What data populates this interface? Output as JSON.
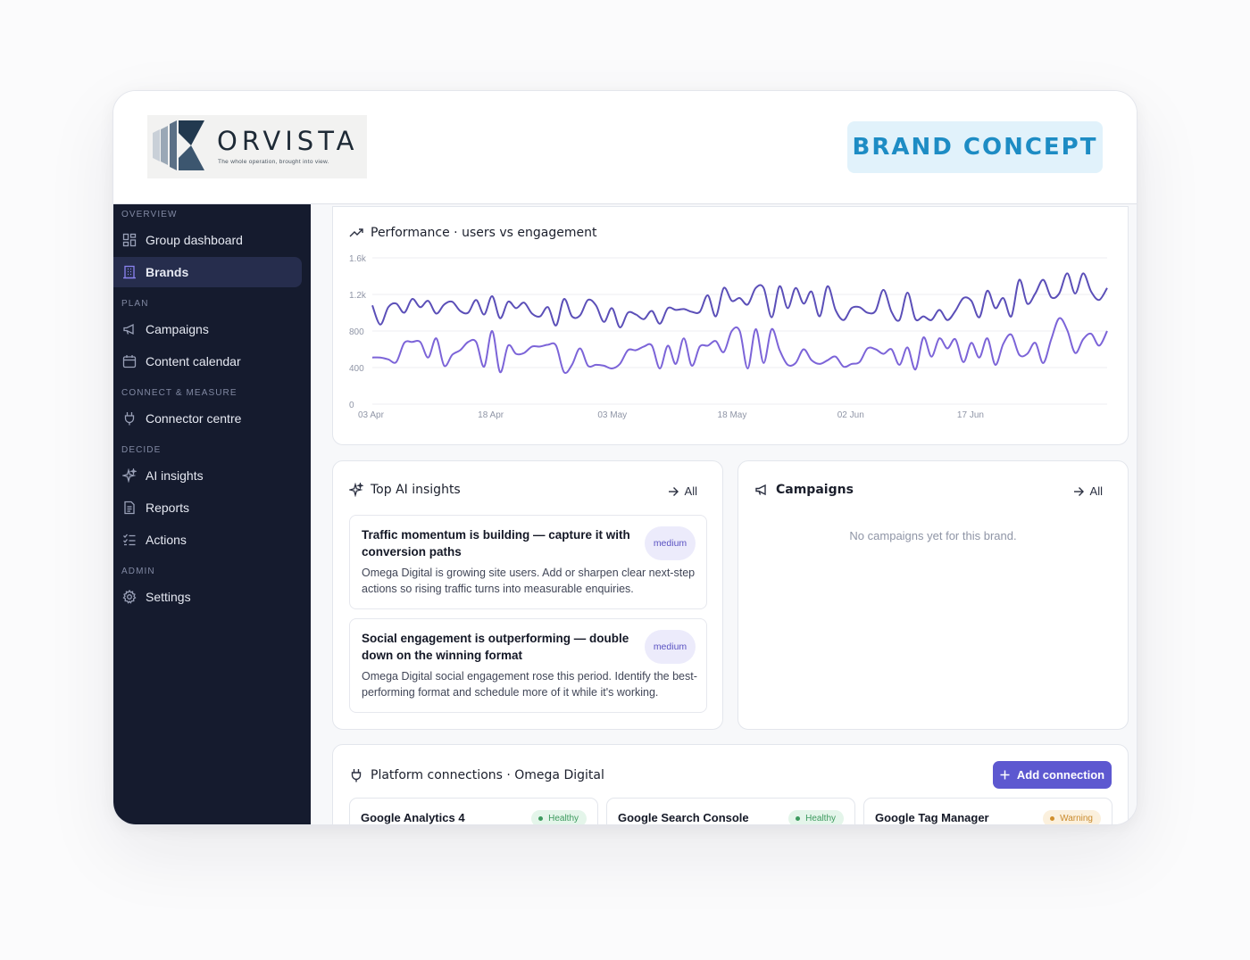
{
  "brand": {
    "logo_word": "ORVISTA",
    "logo_tagline": "The whole operation, brought into view.",
    "badge": "BRAND CONCEPT"
  },
  "sidebar": {
    "sections": {
      "overview": "OVERVIEW",
      "plan": "PLAN",
      "connect": "CONNECT & MEASURE",
      "decide": "DECIDE",
      "admin": "ADMIN"
    },
    "items": {
      "group_dashboard": "Group dashboard",
      "brands": "Brands",
      "campaigns": "Campaigns",
      "content_calendar": "Content calendar",
      "connector_centre": "Connector centre",
      "ai_insights": "AI insights",
      "reports": "Reports",
      "actions": "Actions",
      "settings": "Settings"
    }
  },
  "performance": {
    "title": "Performance · users vs engagement"
  },
  "chart_data": {
    "type": "line",
    "title": "Performance · users vs engagement",
    "xlabel": "",
    "ylabel": "",
    "ylim": [
      0,
      1600
    ],
    "yticks": [
      "1.6k",
      "1.2k",
      "800",
      "400",
      "0"
    ],
    "xticks": [
      "03 Apr",
      "18 Apr",
      "03 May",
      "18 May",
      "02 Jun",
      "17 Jun"
    ],
    "xtick_index": [
      0,
      15,
      30,
      45,
      60,
      75
    ],
    "grid": true,
    "series": [
      {
        "color": "#5b4fb8",
        "values": [
          1080,
          870,
          1060,
          1100,
          1000,
          1150,
          1060,
          1130,
          990,
          1090,
          1120,
          1020,
          1000,
          1140,
          980,
          1180,
          940,
          1120,
          1050,
          1110,
          990,
          960,
          1060,
          860,
          1150,
          960,
          970,
          1140,
          1080,
          900,
          1050,
          840,
          1000,
          980,
          930,
          1020,
          880,
          1050,
          1030,
          1040,
          1010,
          1010,
          1190,
          960,
          1270,
          1130,
          1160,
          1090,
          1270,
          1270,
          950,
          1290,
          1050,
          1270,
          1100,
          1230,
          960,
          1290,
          1030,
          920,
          1050,
          1060,
          1000,
          1020,
          1250,
          1010,
          920,
          1220,
          930,
          960,
          920,
          1030,
          920,
          1020,
          1160,
          1130,
          950,
          1240,
          1050,
          1160,
          960,
          1360,
          1100,
          1210,
          1360,
          1170,
          1210,
          1430,
          1210,
          1430,
          1230,
          1140,
          1270
        ]
      },
      {
        "color": "#7c64d8",
        "values": [
          510,
          510,
          490,
          460,
          670,
          680,
          680,
          510,
          720,
          420,
          540,
          590,
          680,
          680,
          410,
          800,
          350,
          640,
          550,
          560,
          630,
          630,
          650,
          640,
          350,
          430,
          610,
          420,
          430,
          420,
          390,
          440,
          590,
          590,
          630,
          640,
          390,
          640,
          440,
          720,
          420,
          630,
          640,
          690,
          570,
          800,
          800,
          390,
          820,
          450,
          820,
          590,
          430,
          450,
          600,
          480,
          440,
          480,
          520,
          410,
          440,
          460,
          610,
          600,
          550,
          600,
          430,
          620,
          380,
          730,
          520,
          720,
          610,
          710,
          460,
          670,
          510,
          720,
          430,
          660,
          760,
          540,
          550,
          670,
          450,
          710,
          940,
          810,
          560,
          710,
          770,
          640,
          800
        ]
      }
    ]
  },
  "insights": {
    "title": "Top AI insights",
    "all_label": "All",
    "items": [
      {
        "title": "Traffic momentum is building — capture it with conversion paths",
        "priority": "medium",
        "body": "Omega Digital is growing site users. Add or sharpen clear next-step actions so rising traffic turns into measurable enquiries."
      },
      {
        "title": "Social engagement is outperforming — double down on the winning format",
        "priority": "medium",
        "body": "Omega Digital social engagement rose this period. Identify the best-performing format and schedule more of it while it's working."
      }
    ]
  },
  "campaigns": {
    "title": "Campaigns",
    "all_label": "All",
    "empty": "No campaigns yet for this brand."
  },
  "connections": {
    "title": "Platform connections · Omega Digital",
    "add_label": "Add connection",
    "items": [
      {
        "name": "Google Analytics 4",
        "status": "Healthy"
      },
      {
        "name": "Google Search Console",
        "status": "Healthy"
      },
      {
        "name": "Google Tag Manager",
        "status": "Warning"
      }
    ]
  },
  "colors": {
    "sidebar_bg": "#151b2e",
    "accent": "#5d58d0",
    "badge_text": "#1d8cc4",
    "healthy": "#3d9a5e",
    "warning": "#d1902e"
  }
}
